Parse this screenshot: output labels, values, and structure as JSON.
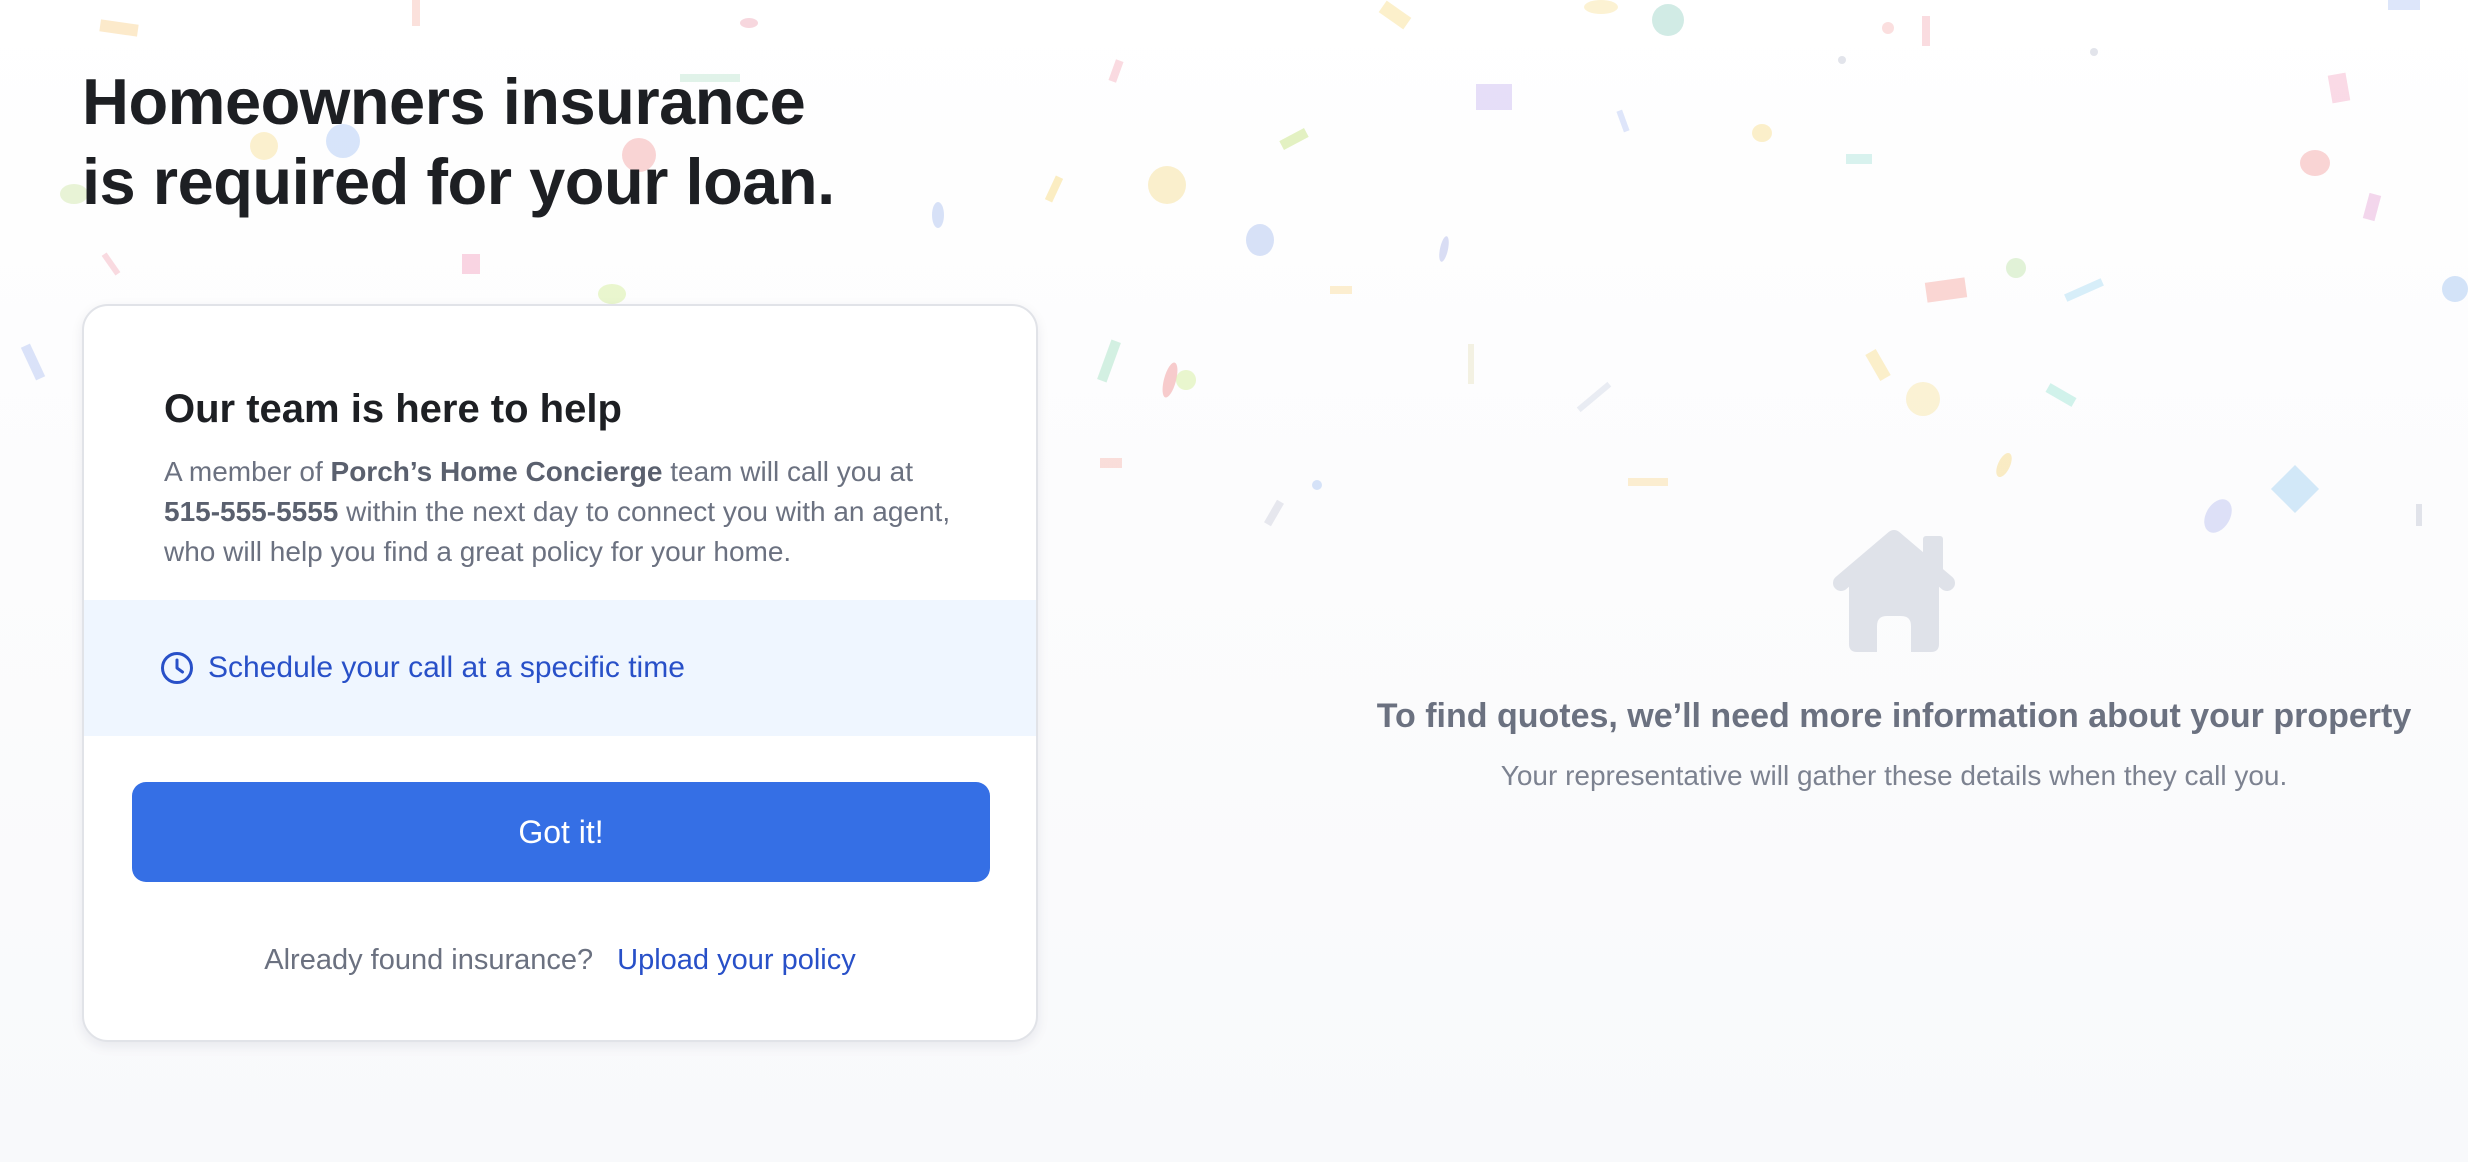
{
  "page": {
    "title_line_1": "Homeowners insurance",
    "title_line_2": "is required for your loan."
  },
  "card": {
    "title": "Our team is here to help",
    "body": {
      "prefix": "A member of ",
      "company": "Porch’s Home Concierge",
      "middle": " team will call you at ",
      "phone": "515-555-5555",
      "suffix": " within the next day to connect you with an agent, who will help you find a great policy for your home."
    },
    "schedule": {
      "icon": "clock-icon",
      "label": "Schedule your call at a specific time"
    },
    "primary_button": "Got it!",
    "footer": {
      "question": "Already found insurance?",
      "link": "Upload your policy"
    }
  },
  "empty_state": {
    "icon": "house-icon",
    "title": "To find quotes, we’ll need more information about your property",
    "subtitle": "Your representative will gather these details when they call you."
  },
  "colors": {
    "primary": "#356fe5",
    "link": "#2850c8",
    "band": "#eff6ff",
    "muted_text": "#6b7180",
    "house_icon": "#dfe2e9"
  }
}
